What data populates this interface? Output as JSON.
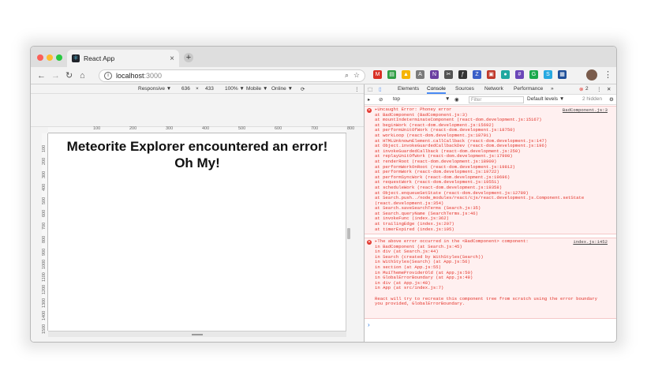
{
  "browser": {
    "tab_title": "React App",
    "tab_close": "×",
    "new_tab": "+",
    "url_host": "localhost",
    "url_port": ":3000",
    "extensions": [
      {
        "label": "M",
        "color": "#d93025"
      },
      {
        "label": "▤",
        "color": "#2f9e44"
      },
      {
        "label": "▲",
        "color": "#f6b400"
      },
      {
        "label": "A",
        "color": "#7b7b7b"
      },
      {
        "label": "N",
        "color": "#6a3ea1"
      },
      {
        "label": "✂",
        "color": "#555555"
      },
      {
        "label": "ƒ",
        "color": "#333333"
      },
      {
        "label": "Z",
        "color": "#3a5fc8"
      },
      {
        "label": "▣",
        "color": "#c0392b"
      },
      {
        "label": "●",
        "color": "#20a8a0"
      },
      {
        "label": "#",
        "color": "#6b47b8"
      },
      {
        "label": "G",
        "color": "#1ba94c"
      },
      {
        "label": "S",
        "color": "#27a9e1"
      },
      {
        "label": "▦",
        "color": "#1f4f99"
      }
    ]
  },
  "device_toolbar": {
    "responsive": "Responsive ▼",
    "width": "636",
    "times": "×",
    "height": "433",
    "zoom": "100% ▼",
    "device": "Mobile ▼",
    "network": "Online ▼",
    "ruler_labels": [
      "100",
      "200",
      "300",
      "400",
      "500",
      "600",
      "700",
      "800"
    ],
    "vruler_labels": [
      "100",
      "200",
      "300",
      "400",
      "500",
      "600",
      "700",
      "800",
      "900",
      "1000",
      "1100",
      "1200",
      "1300",
      "1400",
      "1500"
    ]
  },
  "page": {
    "error_line1": "Meteorite Explorer encountered an error!",
    "error_line2": "Oh My!"
  },
  "devtools": {
    "tabs": [
      "Elements",
      "Console",
      "Sources",
      "Network",
      "Performance",
      "»"
    ],
    "error_count": "2",
    "context": "top",
    "filter_placeholder": "Filter",
    "levels": "Default levels ▼",
    "hidden": "2 hidden",
    "error1_source": "BadComponent.js:3",
    "error1_lines": [
      "▸Uncaught Error: Phoney error",
      "    at BadComponent (BadComponent.js:3)",
      "    at mountIndeterminateComponent (react-dom.development.js:15167)",
      "    at beginWork (react-dom.development.js:15692)",
      "    at performUnitOfWork (react-dom.development.js:18750)",
      "    at workLoop (react-dom.development.js:18791)",
      "    at HTMLUnknownElement.callCallback (react-dom.development.js:147)",
      "    at Object.invokeGuardedCallbackDev (react-dom.development.js:196)",
      "    at invokeGuardedCallback (react-dom.development.js:250)",
      "    at replayUnitOfWork (react-dom.development.js:17998)",
      "    at renderRoot (react-dom.development.js:18909)",
      "    at performWorkOnRoot (react-dom.development.js:19812)",
      "    at performWork (react-dom.development.js:19722)",
      "    at performSyncWork (react-dom.development.js:19696)",
      "    at requestWork (react-dom.development.js:19551)",
      "    at scheduleWork (react-dom.development.js:19358)",
      "    at Object.enqueueSetState (react-dom.development.js:12789)",
      "    at Search.push../node_modules/react/cjs/react.development.js.Component.setState",
      "(react.development.js:354)",
      "    at Search.saveSearchTerms (Search.js:35)",
      "    at Search.queryName (SearchTerms.js:46)",
      "    at invokeFunc (index.js:362)",
      "    at trailingEdge (index.js:207)",
      "    at timerExpired (index.js:195)"
    ],
    "error2_source": "index.js:1452",
    "error2_lines": [
      "▸The above error occurred in the <BadComponent> component:",
      "    in BadComponent (at Search.js:45)",
      "    in div (at Search.js:44)",
      "    in Search (created by WithStyles(Search))",
      "    in WithStyles(Search) (at App.js:56)",
      "    in section (at App.js:55)",
      "    in MuiThemeProviderOld (at App.js:50)",
      "    in GlobalErrorBoundary (at App.js:49)",
      "    in div (at App.js:48)",
      "    in App (at src/index.js:7)",
      "",
      "React will try to recreate this component tree from scratch using the error boundary",
      "you provided, GlobalErrorBoundary."
    ],
    "prompt": "›"
  }
}
